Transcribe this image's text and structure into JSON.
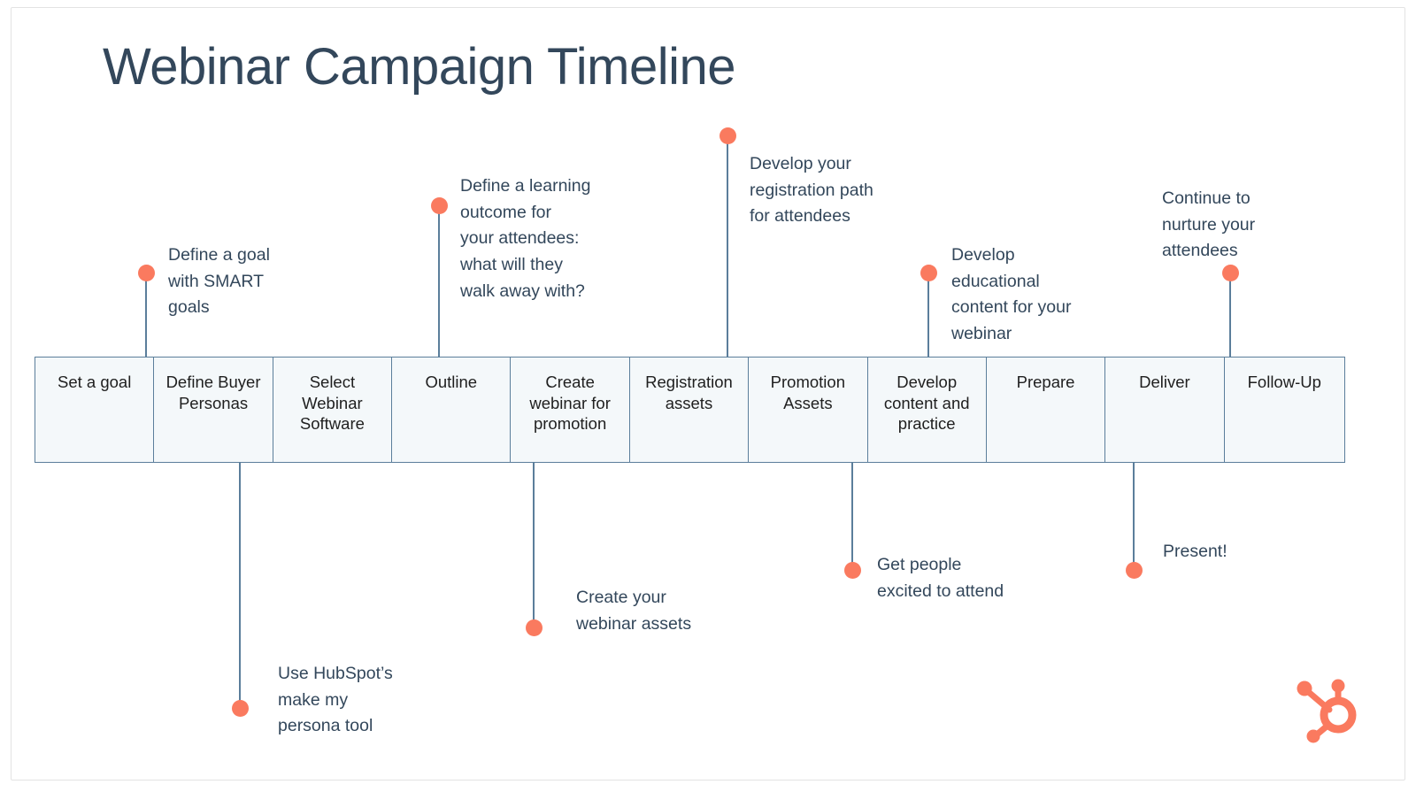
{
  "page": {
    "title": "Webinar Campaign Timeline",
    "brand_logo": "hubspot-sprocket-logo"
  },
  "colors": {
    "accent_orange": "#fa7a5f",
    "line_blue": "#5b7e9b",
    "text_navy": "#33475b",
    "cell_background": "#f4f8fa",
    "canvas_background": "#ffffff",
    "frame_border": "#e3e3e3"
  },
  "timeline": {
    "stages": [
      {
        "label": "Set a goal"
      },
      {
        "label": "Define\nBuyer\nPersonas"
      },
      {
        "label": "Select\nWebinar\nSoftware"
      },
      {
        "label": "Outline"
      },
      {
        "label": "Create\nwebinar for\npromotion"
      },
      {
        "label": "Registration\nassets"
      },
      {
        "label": "Promotion\nAssets"
      },
      {
        "label": "Develop\ncontent\nand\npractice"
      },
      {
        "label": "Prepare"
      },
      {
        "label": "Deliver"
      },
      {
        "label": "Follow-Up"
      }
    ]
  },
  "annotations": {
    "above": [
      {
        "id": "smart-goals",
        "text": "Define a goal\nwith SMART\ngoals"
      },
      {
        "id": "learning-outcome",
        "text": "Define a learning\noutcome for\nyour attendees:\nwhat will they\nwalk away with?"
      },
      {
        "id": "registration-path",
        "text": "Develop your\nregistration path\nfor attendees"
      },
      {
        "id": "educational-content",
        "text": "Develop\neducational\ncontent for your\nwebinar"
      },
      {
        "id": "nurture-attendees",
        "text": "Continue to\nnurture your\nattendees"
      }
    ],
    "below": [
      {
        "id": "persona-tool",
        "text": "Use HubSpot’s\nmake my\npersona tool"
      },
      {
        "id": "webinar-assets",
        "text": "Create your\nwebinar assets"
      },
      {
        "id": "get-people-excited",
        "text": "Get people\nexcited to attend"
      },
      {
        "id": "present",
        "text": "Present!"
      }
    ]
  }
}
